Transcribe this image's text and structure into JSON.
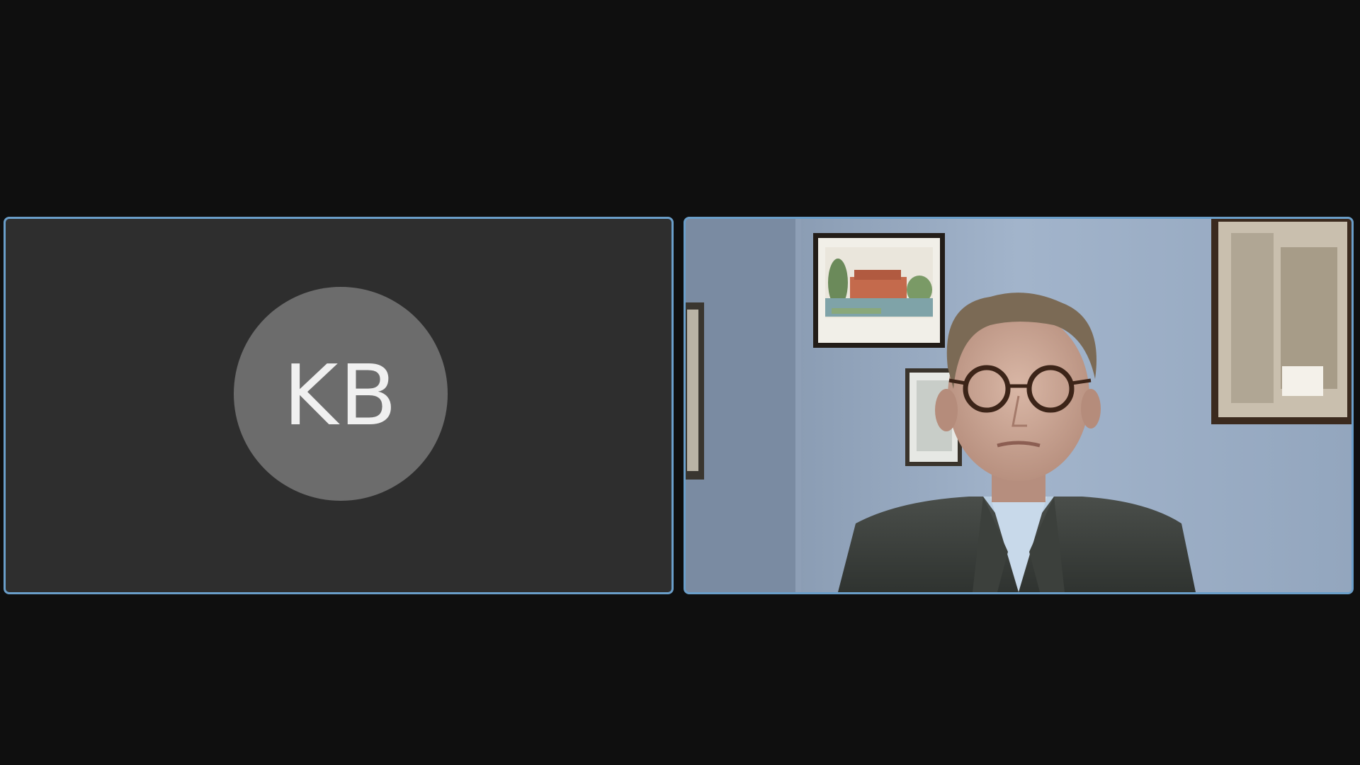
{
  "participants": [
    {
      "initials": "KB",
      "video_on": false,
      "avatar_color": "#6c6c6c",
      "tile_background": "#2e2e2e",
      "active_speaker_border": "#6a9ec9"
    },
    {
      "video_on": true,
      "tile_border": "#6a9ec9"
    }
  ],
  "stage_background": "#0f0f0f"
}
